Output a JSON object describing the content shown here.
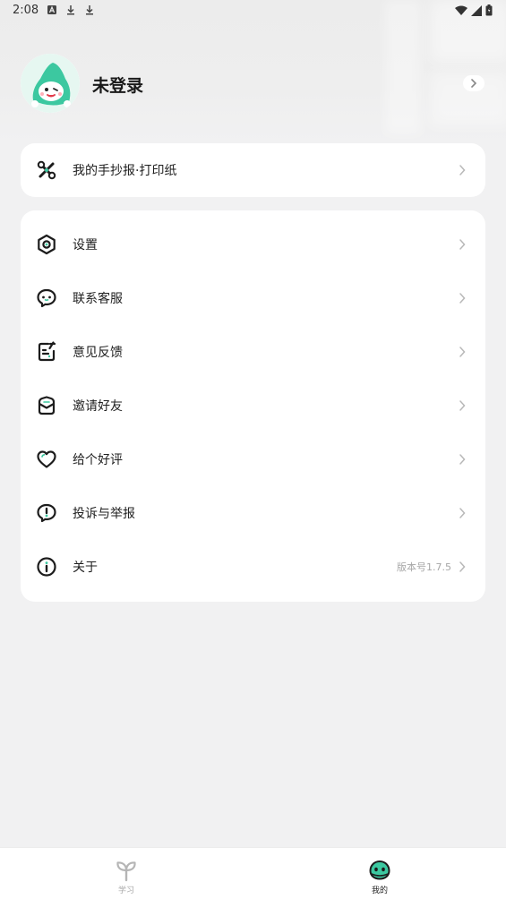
{
  "status_bar": {
    "time": "2:08",
    "left_icons": [
      "notification-a-icon",
      "download-icon",
      "download-icon"
    ],
    "right_icons": [
      "wifi-icon",
      "cell-signal-icon",
      "battery-icon"
    ]
  },
  "profile": {
    "name": "未登录",
    "avatar": "mascot-avatar"
  },
  "featured": {
    "label": "我的手抄报·打印纸",
    "icon": "craft-icon"
  },
  "menu": {
    "items": [
      {
        "label": "设置",
        "icon": "settings-icon"
      },
      {
        "label": "联系客服",
        "icon": "chat-icon"
      },
      {
        "label": "意见反馈",
        "icon": "feedback-icon"
      },
      {
        "label": "邀请好友",
        "icon": "invite-icon"
      },
      {
        "label": "给个好评",
        "icon": "heart-icon"
      },
      {
        "label": "投诉与举报",
        "icon": "report-icon"
      },
      {
        "label": "关于",
        "icon": "info-icon",
        "extra": "版本号1.7.5"
      }
    ]
  },
  "nav": {
    "tabs": [
      {
        "label": "学习",
        "icon": "sprout-icon",
        "active": false
      },
      {
        "label": "我的",
        "icon": "mine-face-icon",
        "active": true
      }
    ]
  },
  "colors": {
    "accent": "#3cc8a0",
    "background": "#f1f1f2",
    "card": "#ffffff",
    "text": "#1f1f1f"
  }
}
